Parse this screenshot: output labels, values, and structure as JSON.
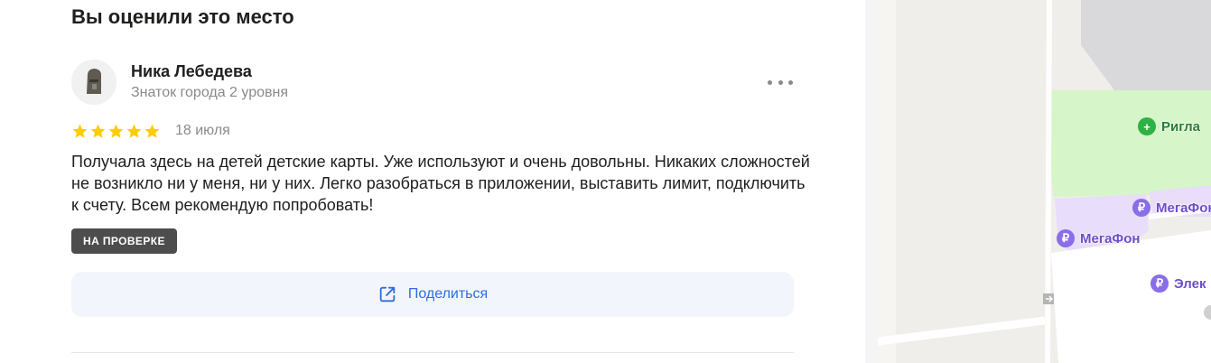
{
  "review": {
    "section_title": "Вы оценили это место",
    "author_name": "Ника Лебедева",
    "author_level": "Знаток города 2 уровня",
    "rating": 5,
    "date": "18 июля",
    "text": "Получала здесь на детей детские карты. Уже используют и очень довольны. Никаких сложностей не возникло ни у меня, ни у них. Легко разобраться в приложении, выставить лимит, подключить к счету. Всем рекомендую попробовать!",
    "status_badge": "НА ПРОВЕРКЕ",
    "share_label": "Поделиться"
  },
  "map": {
    "pois": [
      {
        "name": "Ригла",
        "icon": "pharmacy-cross-icon"
      },
      {
        "name": "МегаФон",
        "icon": "ruble-icon"
      },
      {
        "name": "МегаФон",
        "icon": "ruble-icon"
      },
      {
        "name": "Элек",
        "icon": "ruble-icon"
      }
    ]
  },
  "colors": {
    "accent": "#2f6de1",
    "star": "#fc0",
    "badge_bg": "#4d4d4d",
    "share_bg": "#f2f5fb",
    "map_green": "#d6f5c9",
    "map_purple": "#e8ddfb"
  }
}
